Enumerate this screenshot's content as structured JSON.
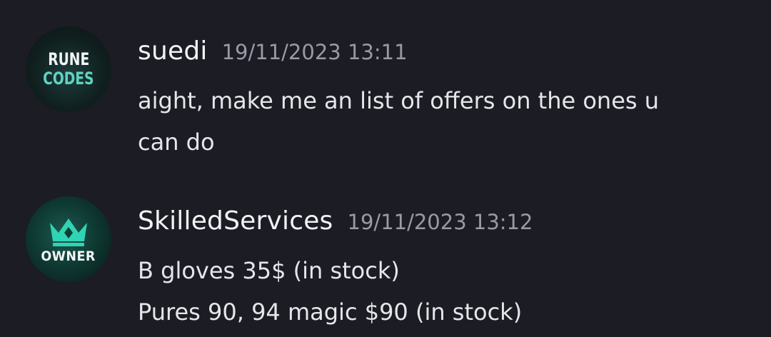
{
  "messages": [
    {
      "username": "suedi",
      "timestamp": "19/11/2023 13:11",
      "avatar": {
        "line1": "RUNE",
        "line2": "CODES"
      },
      "lines": [
        "aight, make me an list of offers on the ones u",
        "can do"
      ]
    },
    {
      "username": "SkilledServices",
      "timestamp": "19/11/2023 13:12",
      "avatar": {
        "label": "OWNER",
        "icon": "crown-icon"
      },
      "lines": [
        "B gloves 35$ (in stock)",
        "Pures 90, 94 magic $90 (in stock)"
      ]
    }
  ],
  "colors": {
    "background": "#1c1c25",
    "username": "#f2f3f5",
    "timestamp": "#9a9aa6",
    "message_text": "#e6e6ea",
    "crown_accent": "#2fd4b4"
  }
}
